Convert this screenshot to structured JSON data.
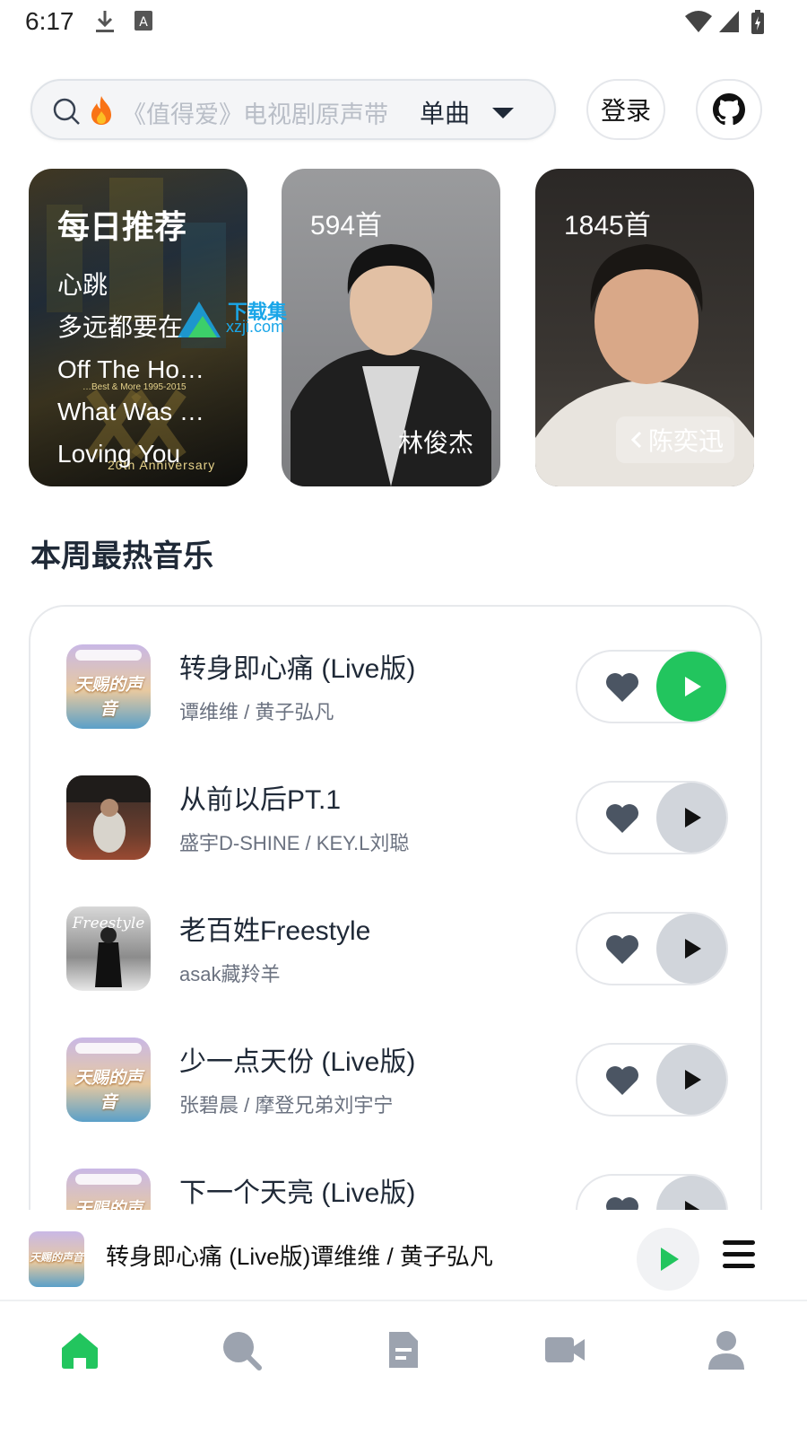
{
  "status_bar": {
    "time": "6:17"
  },
  "search": {
    "placeholder": "《值得爱》电视剧原声带",
    "type_label": "单曲"
  },
  "header": {
    "login_label": "登录"
  },
  "cards": {
    "daily": {
      "title": "每日推荐",
      "songs": [
        "心跳",
        "多远都要在",
        "Off The Ho…",
        "What Was …",
        "Loving You"
      ],
      "album_text_1": "…Best & More 1995-2015",
      "album_text_2": "20th Anniversary"
    },
    "artist_1": {
      "count": "594首",
      "name": "林俊杰"
    },
    "artist_2": {
      "count": "1845首",
      "name": "陈奕迅"
    }
  },
  "watermark": {
    "text": "下载集",
    "url": "xzji.com"
  },
  "section": {
    "title": "本周最热音乐"
  },
  "songs": [
    {
      "title": "转身即心痛 (Live版)",
      "artist": "谭维维 / 黄子弘凡",
      "cover_text": "天赐的声音",
      "playing": true
    },
    {
      "title": "从前以后PT.1",
      "artist": "盛宇D-SHINE / KEY.L刘聪",
      "playing": false
    },
    {
      "title": "老百姓Freestyle",
      "artist": "asak藏羚羊",
      "cover_text": "Freestyle",
      "playing": false
    },
    {
      "title": "少一点天份 (Live版)",
      "artist": "张碧晨 / 摩登兄弟刘宇宁",
      "cover_text": "天赐的声音",
      "playing": false
    },
    {
      "title": "下一个天亮 (Live版)",
      "artist": "",
      "cover_text": "天赐的声音",
      "playing": false
    }
  ],
  "now_playing": {
    "text": "转身即心痛 (Live版)谭维维 / 黄子弘凡",
    "cover_text": "天赐的声音"
  },
  "bottom_nav": [
    {
      "icon": "home-icon",
      "active": true
    },
    {
      "icon": "search-icon",
      "active": false
    },
    {
      "icon": "document-icon",
      "active": false
    },
    {
      "icon": "video-icon",
      "active": false
    },
    {
      "icon": "user-icon",
      "active": false
    }
  ],
  "colors": {
    "accent": "#22c55e",
    "inactive_icon": "#9ca3af",
    "text_primary": "#1f2937",
    "text_secondary": "#6b7280"
  }
}
